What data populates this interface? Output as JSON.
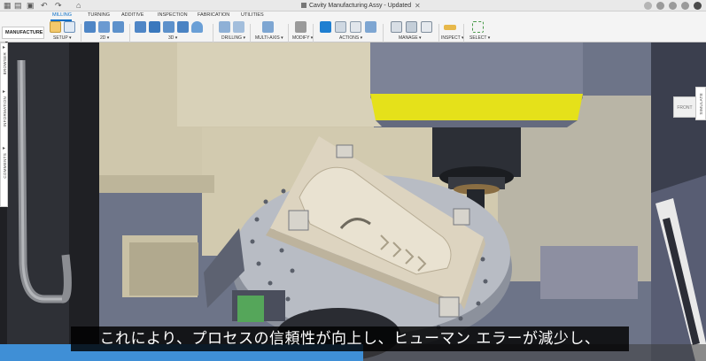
{
  "window": {
    "document_title": "Cavity Manufacturing Assy - Updated v2*"
  },
  "toolbar": {
    "workspace": "MANUFACTURE ▾",
    "tabs": [
      "MILLING",
      "TURNING",
      "ADDITIVE",
      "INSPECTION",
      "FABRICATION",
      "UTILITIES"
    ],
    "active_tab": "MILLING",
    "groups": [
      "SETUP ▾",
      "2D ▾",
      "3D ▾",
      "DRILLING ▾",
      "MULTI-AXIS ▾",
      "MODIFY ▾",
      "ACTIONS ▾",
      "MANAGE ▾",
      "INSPECT ▾",
      "SELECT ▾"
    ]
  },
  "panels": {
    "left": [
      "BROWSER",
      "INFORMATION",
      "COMMENTS"
    ],
    "right": "SIMULATE"
  },
  "viewcube_label": "FRONT",
  "subtitle": "これにより、プロセスの信頼性が向上し、ヒューマン エラーが減少し、",
  "video_progress": 0.515,
  "colors": {
    "accent": "#0a6ec6",
    "progress": "#3f8fd6",
    "spindle_band": "#e5e11a",
    "part": "#ddd4c0"
  },
  "icons": [
    "apps-icon",
    "file-icon",
    "save-icon",
    "undo-icon",
    "redo-icon",
    "home-icon",
    "close-icon",
    "add-tab-icon",
    "help-icon",
    "notifications-icon",
    "account-avatar"
  ]
}
